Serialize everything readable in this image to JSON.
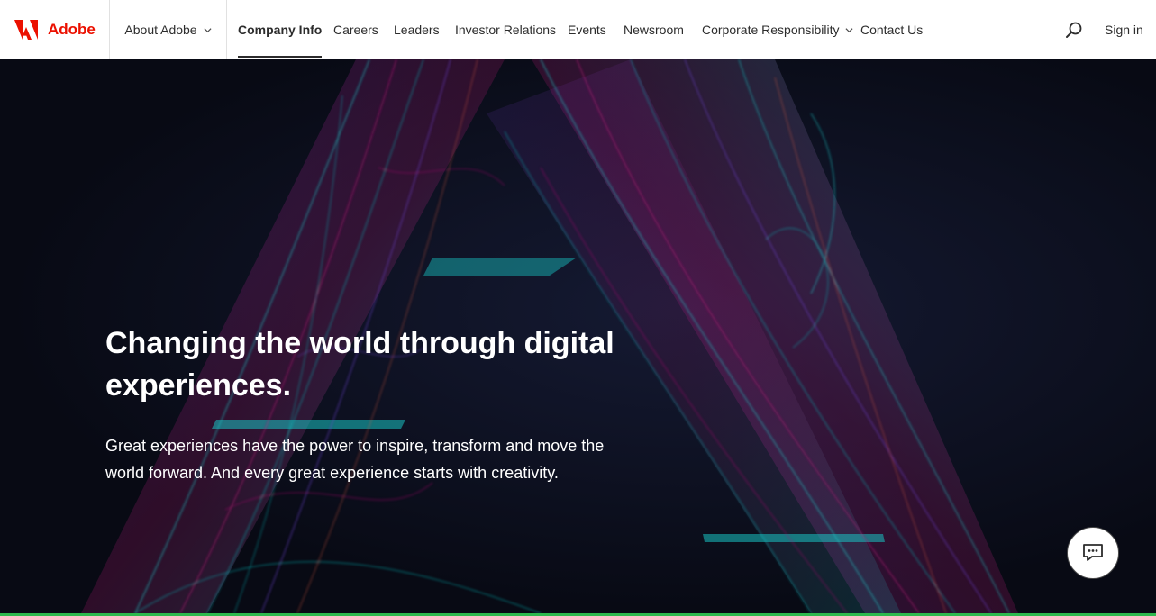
{
  "header": {
    "brand_name": "Adobe",
    "brand_color": "#eb1000",
    "about_label": "About Adobe",
    "nav": [
      {
        "label": "Company Info",
        "active": true
      },
      {
        "label": "Careers"
      },
      {
        "label": "Leaders"
      },
      {
        "label": "Investor Relations"
      },
      {
        "label": "Events"
      },
      {
        "label": "Newsroom"
      },
      {
        "label": "Corporate Responsibility",
        "has_dropdown": true
      },
      {
        "label": "Contact Us"
      }
    ],
    "search_icon": "search-icon",
    "signin_label": "Sign in"
  },
  "hero": {
    "title": "Changing the world through digital experiences.",
    "subtitle": "Great experiences have the power to inspire, transform and move the world forward. And every great experience starts with creativity.",
    "background_colors": [
      "#0b0d18",
      "#19c3c3",
      "#c2197a",
      "#6b3fd1",
      "#e05a3c"
    ]
  },
  "chat": {
    "icon": "chat-bubble-icon"
  }
}
